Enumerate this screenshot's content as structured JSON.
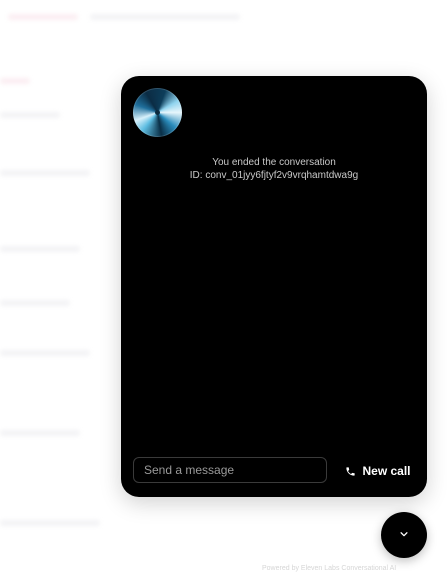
{
  "agent": {
    "avatar_icon": "metallic-orb-avatar"
  },
  "conversation": {
    "status_text": "You ended the conversation",
    "conversation_id": "ID: conv_01jyy6fjtyf2v9vrqhamtdwa9g"
  },
  "composer": {
    "input_value": "",
    "input_placeholder": "Send a message",
    "call_button_label": "New call",
    "call_icon": "phone-icon"
  },
  "fab": {
    "icon": "chevron-down-icon"
  },
  "footer": {
    "powered_by": "Powered by Eleven Labs Conversational AI"
  },
  "colors": {
    "widget_background": "#000000",
    "status_text": "#c9c9c9",
    "input_border": "#3a3a3a",
    "page_background": "#ffffff"
  }
}
